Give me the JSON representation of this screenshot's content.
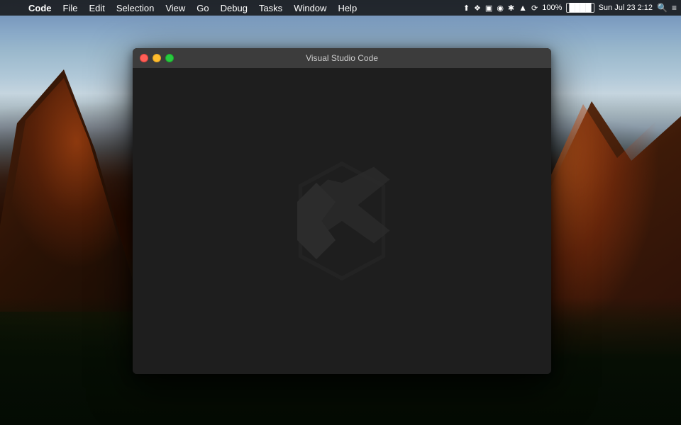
{
  "desktop": {
    "bg_description": "macOS El Capitan Yosemite wallpaper"
  },
  "menubar": {
    "apple_symbol": "",
    "app_name": "Code",
    "menu_items": [
      "File",
      "Edit",
      "Selection",
      "View",
      "Go",
      "Debug",
      "Tasks",
      "Window",
      "Help"
    ],
    "right": {
      "battery_percent": "100%",
      "date_time": "Sun Jul 23  2:12",
      "search_icon": "🔍",
      "list_icon": "≡"
    }
  },
  "vscode_window": {
    "title": "Visual Studio Code",
    "traffic_lights": {
      "close_label": "close",
      "minimize_label": "minimize",
      "maximize_label": "maximize"
    }
  }
}
